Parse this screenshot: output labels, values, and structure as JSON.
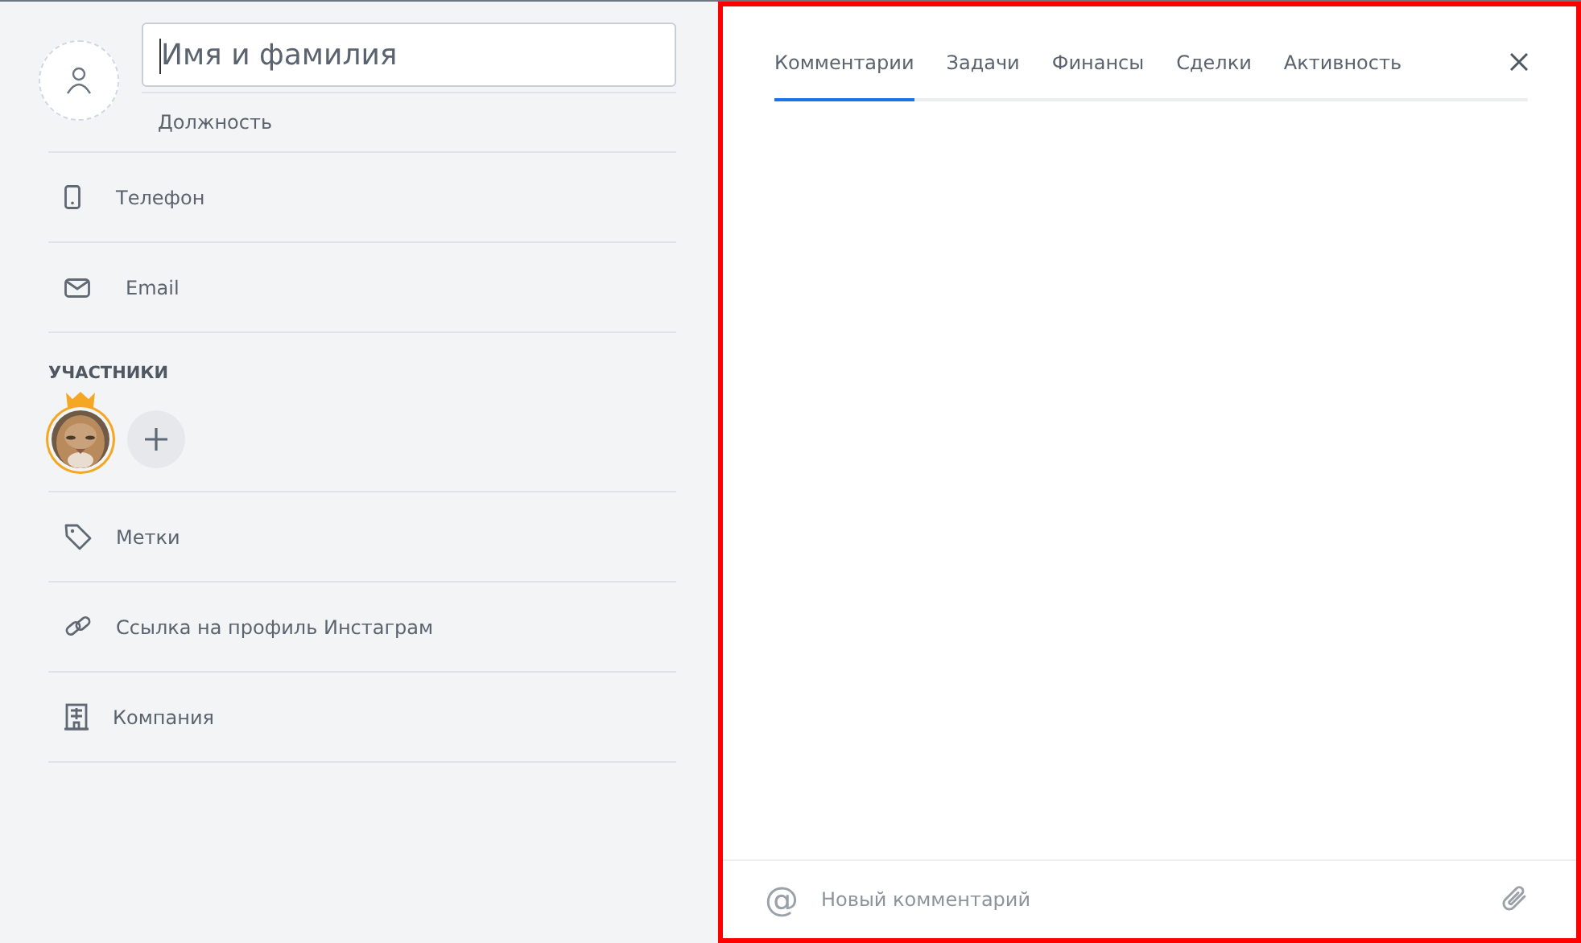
{
  "contact": {
    "name_field": {
      "placeholder": "Имя и фамилия",
      "focused": true
    },
    "position_field": {
      "placeholder": "Должность"
    }
  },
  "fields": [
    {
      "kind": "phone",
      "label": "Телефон"
    },
    {
      "kind": "email",
      "label": "Email"
    }
  ],
  "members": {
    "title": "УЧАСТНИКИ",
    "people": [
      {
        "kind": "picture",
        "owner": true
      }
    ]
  },
  "extra_fields": [
    {
      "kind": "tag",
      "label": "Метки"
    },
    {
      "kind": "link",
      "label": "Ссылка на профиль Инстаграм"
    },
    {
      "kind": "company",
      "label": "Компания"
    }
  ],
  "tabs": [
    {
      "label": "Комментарии",
      "selected": true
    },
    {
      "label": "Задачи",
      "selected": false
    },
    {
      "label": "Финансы",
      "selected": false
    },
    {
      "label": "Сделки",
      "selected": false
    },
    {
      "label": "Активность",
      "selected": false
    }
  ],
  "comment": {
    "mention": "@",
    "placeholder": "Новый комментарий"
  }
}
